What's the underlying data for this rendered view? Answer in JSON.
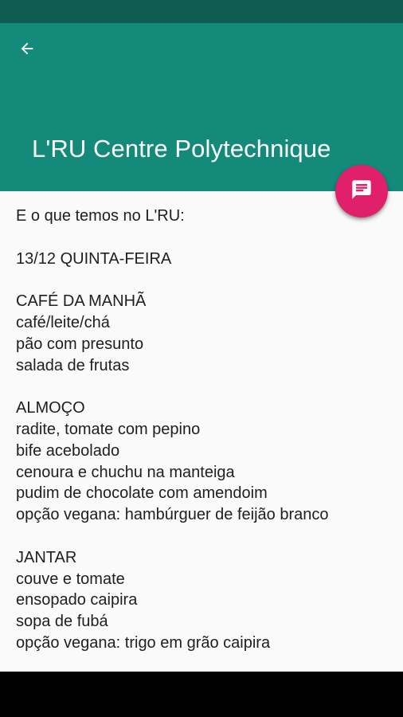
{
  "app_bar": {
    "title": "L'RU Centre Polytechnique",
    "back_icon": "arrow-back-icon",
    "color": "#138a7a"
  },
  "status_bar": {
    "color": "#0e5c52"
  },
  "fab": {
    "icon": "message-icon",
    "color": "#e0206a"
  },
  "content": {
    "intro": "E o que temos no L'RU:",
    "date": "13/12 QUINTA-FEIRA",
    "breakfast": {
      "heading": "CAFÉ DA MANHÃ",
      "items": [
        "café/leite/chá",
        "pão com presunto",
        "salada de frutas"
      ]
    },
    "lunch": {
      "heading": "ALMOÇO",
      "items": [
        "radite, tomate com pepino",
        "bife acebolado",
        "cenoura e chuchu na manteiga",
        "pudim de chocolate com amendoim",
        "opção vegana: hambúrguer de feijão branco"
      ]
    },
    "dinner": {
      "heading": "JANTAR",
      "items": [
        "couve e tomate",
        "ensopado caipira",
        "sopa de fubá",
        "opção vegana: trigo em grão caipira"
      ]
    }
  }
}
